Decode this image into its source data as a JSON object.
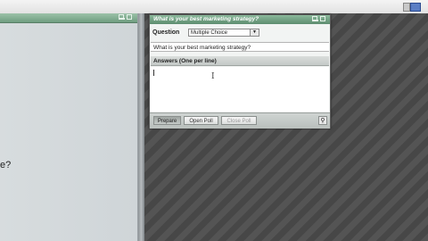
{
  "left_panel": {
    "partial_text": "e?"
  },
  "poll": {
    "title": "What is your best marketing strategy?",
    "question_label": "Question",
    "type_selected": "Multiple Choice",
    "question_value": "What is your best marketing strategy?",
    "answers_label": "Answers (One per line)",
    "answers_value": "",
    "buttons": {
      "prepare": "Prepare",
      "open": "Open Poll",
      "close": "Close Poll"
    }
  },
  "colors": {
    "title_bar": "#6f9d80",
    "workspace": "#4a4a4a"
  }
}
